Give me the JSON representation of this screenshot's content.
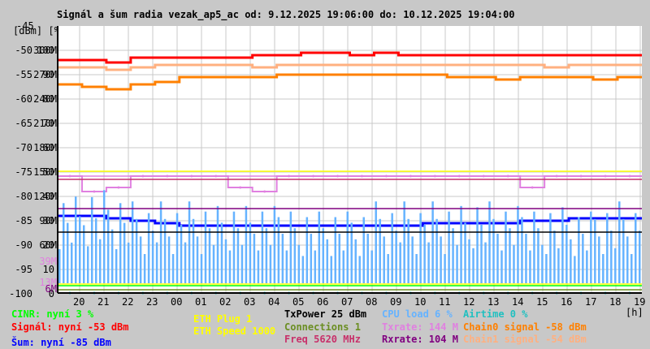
{
  "title": "Signál a šum radia vezak_ap5_ac od: 9.12.2025 19:06:00 do: 10.12.2025 19:04:00",
  "y_axis": {
    "top_label": "-45",
    "units_label": "[dBm] [%]",
    "rows": [
      {
        "dbm": "-50",
        "pct": "100",
        "m": "300M"
      },
      {
        "dbm": "-55",
        "pct": "90",
        "m": "270M"
      },
      {
        "dbm": "-60",
        "pct": "80",
        "m": "240M"
      },
      {
        "dbm": "-65",
        "pct": "70",
        "m": "210M"
      },
      {
        "dbm": "-70",
        "pct": "60",
        "m": "180M"
      },
      {
        "dbm": "-75",
        "pct": "50",
        "m": "150M"
      },
      {
        "dbm": "-80",
        "pct": "40",
        "m": "120M"
      },
      {
        "dbm": "-85",
        "pct": "30",
        "m": "90M"
      },
      {
        "dbm": "-90",
        "pct": "20",
        "m": "60M"
      },
      {
        "dbm": "-95",
        "pct": "10",
        "m": ""
      },
      {
        "dbm": "-100",
        "pct": "0",
        "m": ""
      }
    ],
    "extra_labels": [
      {
        "text": "39M",
        "color": "#e080e0"
      },
      {
        "text": "13M",
        "color": "#e080e0"
      },
      {
        "text": "6M",
        "color": "#800080"
      }
    ]
  },
  "x_axis": {
    "ticks": [
      "20",
      "21",
      "22",
      "23",
      "00",
      "01",
      "02",
      "03",
      "04",
      "05",
      "06",
      "07",
      "08",
      "09",
      "10",
      "11",
      "12",
      "13",
      "14",
      "15",
      "16",
      "17",
      "18",
      "19"
    ],
    "unit": "[h]"
  },
  "legend": {
    "cinr": {
      "text": "CINR: nyní 3 %",
      "color": "#00ff00"
    },
    "signal": {
      "text": "Signál: nyní -53 dBm",
      "color": "#ff0000"
    },
    "noise": {
      "text": "Šum: nyní -85 dBm",
      "color": "#0000ff"
    },
    "eth_plug": {
      "text": "ETH Plug 1",
      "color": "#ffff00"
    },
    "eth_speed": {
      "text": "ETH Speed 1000",
      "color": "#ffff00"
    },
    "txpower": {
      "text": "TxPower 25 dBm",
      "color": "#000000"
    },
    "connections": {
      "text": "Connections 1",
      "color": "#6b8e23"
    },
    "freq": {
      "text": "Freq 5620 MHz",
      "color": "#c8306a"
    },
    "cpu": {
      "text": "CPU load 6 %",
      "color": "#66b3ff"
    },
    "txrate": {
      "text": "Txrate: 144 M",
      "color": "#e080e0"
    },
    "rxrate": {
      "text": "Rxrate: 104 M",
      "color": "#800080"
    },
    "airtime": {
      "text": "Airtime 0 %",
      "color": "#20c0c0"
    },
    "chain0": {
      "text": "Chain0 signal -58 dBm",
      "color": "#ff8000"
    },
    "chain1": {
      "text": "Chain1 signal -54 dBm",
      "color": "#ffb080"
    }
  },
  "chart_data": {
    "type": "line",
    "title": "Signál a šum radia vezak_ap5_ac od: 9.12.2025 19:06:00 do: 10.12.2025 19:04:00",
    "x_range": [
      "9.12.2025 19:06:00",
      "10.12.2025 19:04:00"
    ],
    "ylim_dbm": [
      -100,
      -45
    ],
    "ylim_pct": [
      0,
      110
    ],
    "ylim_m": [
      0,
      330
    ],
    "grid": true,
    "x_hours": [
      19.5,
      20.5,
      21.5,
      22.5,
      23.5,
      0.5,
      1.5,
      2.5,
      3.5,
      4.5,
      5.5,
      6.5,
      7.5,
      8.5,
      9.5,
      10.5,
      11.5,
      12.5,
      13.5,
      14.5,
      15.5,
      16.5,
      17.5,
      18.5
    ],
    "series": [
      {
        "name": "Chain1 signal",
        "unit": "dBm",
        "color": "#ffb080",
        "values": [
          -53.5,
          -53.5,
          -54,
          -53.5,
          -53,
          -53,
          -53,
          -53,
          -53.5,
          -53,
          -53,
          -53,
          -53,
          -53,
          -53,
          -53,
          -53,
          -53,
          -53,
          -53,
          -53.5,
          -53,
          -53,
          -53
        ]
      },
      {
        "name": "Chain0 signal",
        "unit": "dBm",
        "color": "#ff8000",
        "values": [
          -57,
          -57.5,
          -58,
          -57,
          -56.5,
          -55.5,
          -55.5,
          -55.5,
          -55.5,
          -55,
          -55,
          -55,
          -55,
          -55,
          -55,
          -55,
          -55.5,
          -55.5,
          -56,
          -55.5,
          -55.5,
          -55.5,
          -56,
          -55.5
        ]
      },
      {
        "name": "Signál",
        "unit": "dBm",
        "color": "#ff0000",
        "values": [
          -52,
          -52,
          -52.5,
          -51.5,
          -51.5,
          -51.5,
          -51.5,
          -51.5,
          -51,
          -51,
          -50.5,
          -50.5,
          -51,
          -50.5,
          -51,
          -51,
          -51,
          -51,
          -51,
          -51,
          -51,
          -51,
          -51,
          -51
        ]
      },
      {
        "name": "Šum",
        "unit": "dBm",
        "color": "#0000ff",
        "values": [
          -84,
          -84,
          -84.5,
          -85,
          -85.5,
          -86,
          -86,
          -86,
          -86,
          -86,
          -86,
          -86,
          -86,
          -86,
          -86,
          -85.5,
          -85.5,
          -85.5,
          -85.5,
          -85,
          -85,
          -84.5,
          -84.5,
          -84.5
        ]
      },
      {
        "name": "Txrate",
        "unit": "M",
        "color": "#e080e0",
        "values": [
          144,
          125,
          130,
          144,
          144,
          144,
          144,
          130,
          125,
          144,
          144,
          144,
          144,
          144,
          144,
          144,
          144,
          144,
          144,
          130,
          144,
          144,
          144,
          144
        ]
      },
      {
        "name": "CPU load",
        "unit": "%",
        "color": "#66b3ff",
        "min": [
          4,
          4,
          4,
          4,
          4,
          4,
          4,
          4,
          4,
          4,
          4,
          4,
          4,
          4,
          4,
          4,
          4,
          4,
          4,
          4,
          4,
          4,
          4,
          4
        ],
        "max": [
          45,
          48,
          45,
          40,
          40,
          40,
          38,
          38,
          38,
          38,
          38,
          38,
          38,
          40,
          40,
          40,
          38,
          40,
          38,
          38,
          40,
          38,
          40,
          40
        ]
      },
      {
        "name": "Airtime",
        "unit": "%",
        "color": "#20c0c0",
        "values": [
          0,
          0,
          0,
          0,
          0,
          0,
          0,
          0,
          0,
          0,
          0,
          0,
          0,
          0,
          0,
          0,
          0,
          0,
          0,
          0,
          0,
          0,
          0,
          0
        ]
      }
    ],
    "constants": [
      {
        "name": "ETH Speed",
        "value_m": 150,
        "color": "#ffff00"
      },
      {
        "name": "Txrate",
        "value_m": 144,
        "color": "#e080e0"
      },
      {
        "name": "Freq",
        "value_m": 140,
        "color": "#c8306a"
      },
      {
        "name": "Rxrate",
        "value_m": 104,
        "color": "#800080"
      },
      {
        "name": "TxPower",
        "value_pct": 25,
        "color": "#000000"
      },
      {
        "name": "ETH Plug",
        "value_m": 11,
        "color": "#ffff00"
      },
      {
        "name": "CINR",
        "value_pct": 3,
        "color": "#00ff00"
      },
      {
        "name": "Connections",
        "value_m": 4,
        "color": "#6b8e23"
      }
    ]
  }
}
